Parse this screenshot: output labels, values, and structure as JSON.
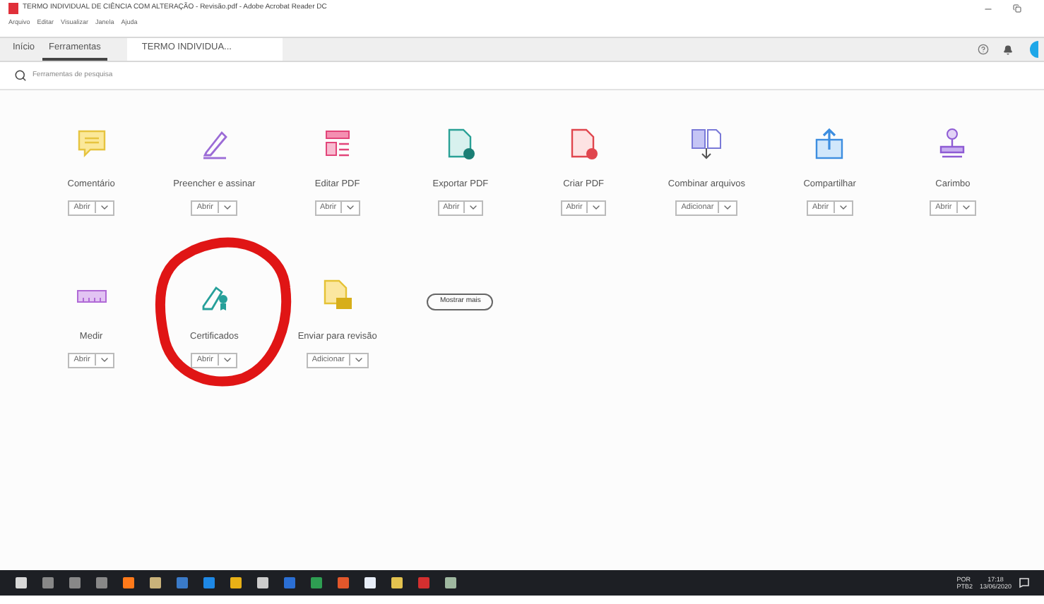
{
  "window": {
    "title": "TERMO INDIVIDUAL DE CIÊNCIA COM ALTERAÇÃO - Revisão.pdf - Adobe Acrobat Reader DC"
  },
  "menu": [
    "Arquivo",
    "Editar",
    "Visualizar",
    "Janela",
    "Ajuda"
  ],
  "tabs": [
    {
      "label": "Início",
      "selected": false
    },
    {
      "label": "Ferramentas",
      "selected": true
    },
    {
      "label": "TERMO INDIVIDUA...",
      "selected": false
    }
  ],
  "search": {
    "placeholder": "Ferramentas de pesquisa"
  },
  "tools": [
    {
      "kind": "comment",
      "label": "Comentário",
      "action": "Abrir"
    },
    {
      "kind": "sign",
      "label": "Preencher e assinar",
      "action": "Abrir"
    },
    {
      "kind": "edit",
      "label": "Editar PDF",
      "action": "Abrir"
    },
    {
      "kind": "export",
      "label": "Exportar PDF",
      "action": "Abrir"
    },
    {
      "kind": "create",
      "label": "Criar PDF",
      "action": "Abrir"
    },
    {
      "kind": "combine",
      "label": "Combinar arquivos",
      "action": "Adicionar"
    },
    {
      "kind": "share",
      "label": "Compartilhar",
      "action": "Abrir"
    },
    {
      "kind": "stamp",
      "label": "Carimbo",
      "action": "Abrir"
    },
    {
      "kind": "measure",
      "label": "Medir",
      "action": "Abrir"
    },
    {
      "kind": "certificate",
      "label": "Certificados",
      "action": "Abrir"
    },
    {
      "kind": "review",
      "label": "Enviar para revisão",
      "action": "Adicionar"
    }
  ],
  "show_more": "Mostrar mais",
  "tray": {
    "language": "POR",
    "layout": "PTB2",
    "time": "17:18",
    "date": "13/06/2020"
  }
}
